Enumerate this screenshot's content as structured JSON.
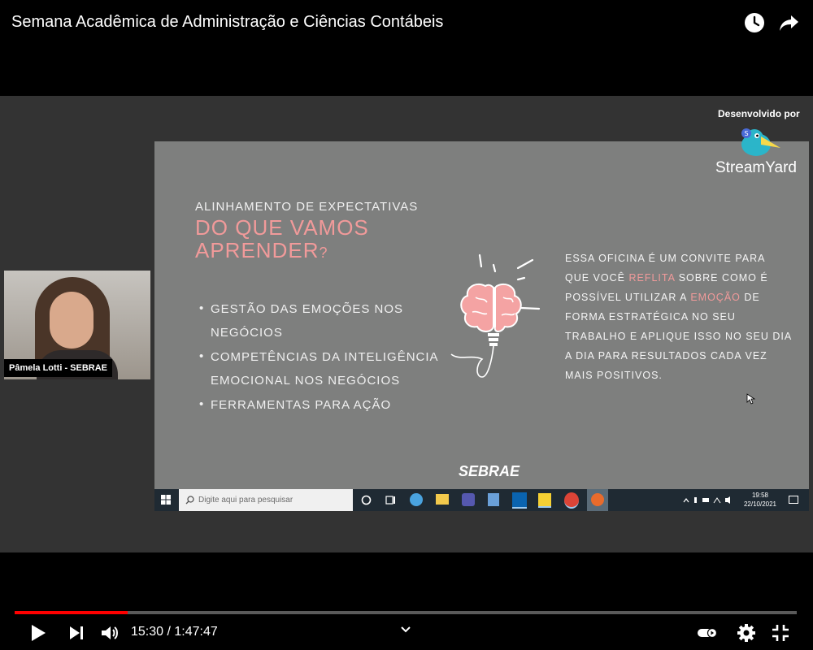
{
  "player": {
    "title": "Semana Acadêmica de Administração e Ciências Contábeis",
    "top_icons": [
      "clock-icon",
      "share-icon"
    ],
    "progress": 0.145,
    "time_current": "15:30",
    "time_total": "1:47:47",
    "time_display": "15:30 / 1:47:47",
    "controls": [
      "play-icon",
      "next-icon",
      "volume-icon",
      "chevron-down-icon",
      "autoplay-toggle",
      "settings-icon",
      "exit-fullscreen-icon"
    ],
    "accent_color": "#ff0000"
  },
  "streamyard": {
    "developed_by": "Desenvolvido por",
    "brand": "StreamYard"
  },
  "participant": {
    "name": "Pâmela Lotti - SEBRAE"
  },
  "slide": {
    "kicker": "ALINHAMENTO DE EXPECTATIVAS",
    "headline": "DO QUE VAMOS APRENDER",
    "headline_mark": "?",
    "bullets": [
      "GESTÃO DAS EMOÇÕES NOS NEGÓCIOS",
      "COMPETÊNCIAS DA INTELIGÊNCIA EMOCIONAL NOS NEGÓCIOS",
      "FERRAMENTAS PARA AÇÃO"
    ],
    "para_1": "ESSA OFICINA É UM CONVITE PARA QUE VOCÊ ",
    "para_hl_1": "REFLITA",
    "para_2": " SOBRE COMO É POSSÍVEL UTILIZAR A ",
    "para_hl_2": "EMOÇÃO",
    "para_3": " DE FORMA ESTRATÉGICA NO SEU TRABALHO E APLIQUE ISSO NO SEU DIA A DIA PARA RESULTADOS CADA VEZ MAIS POSITIVOS.",
    "logo": "SEBRAE",
    "accent_color": "#f19a9a",
    "background_color": "#7e7f7e"
  },
  "taskbar": {
    "search_placeholder": "Digite aqui para pesquisar",
    "time": "19:58",
    "date": "22/10/2021"
  }
}
